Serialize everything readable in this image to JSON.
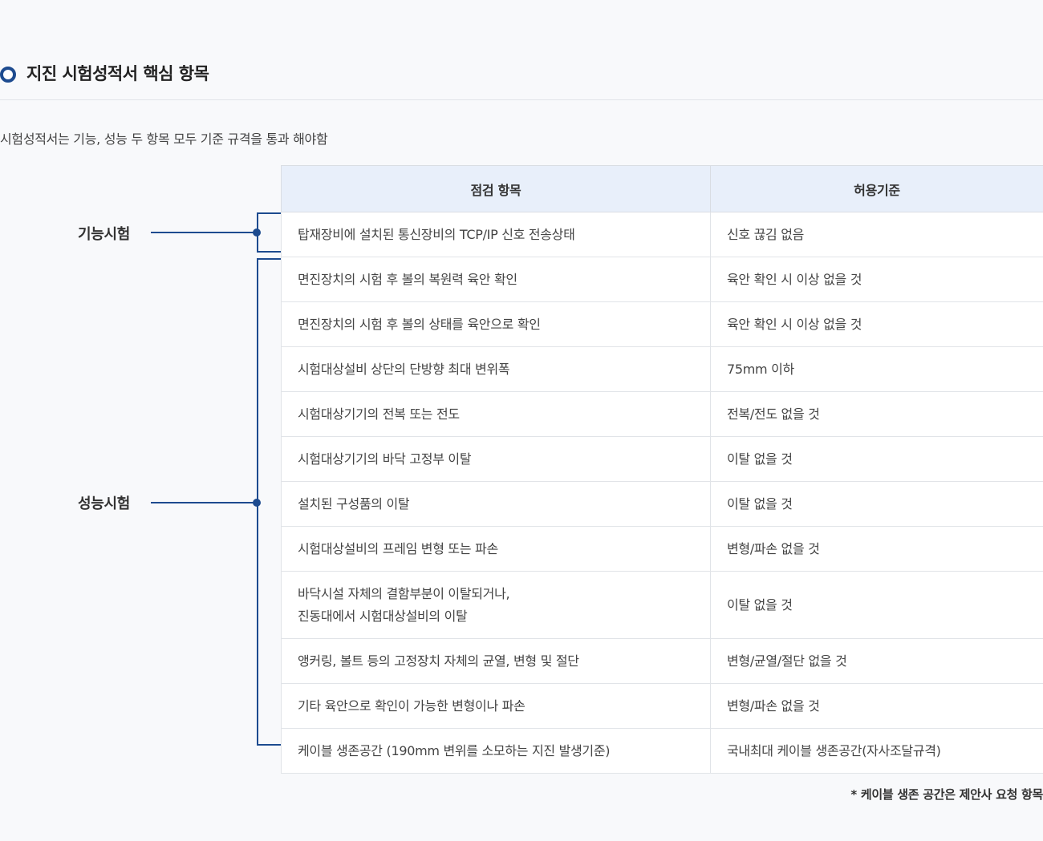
{
  "section": {
    "title": "지진 시험성적서 핵심 항목",
    "intro": "시험성적서는 기능, 성능 두 항목 모두 기준 규격을 통과 해야함"
  },
  "groups": {
    "function": "기능시험",
    "performance": "성능시험"
  },
  "table": {
    "headers": [
      "점검 항목",
      "허용기준"
    ],
    "rows": [
      {
        "item": "탑재장비에 설치된 통신장비의 TCP/IP 신호 전송상태",
        "criterion": "신호 끊김 없음"
      },
      {
        "item": "면진장치의 시험 후 볼의 복원력 육안 확인",
        "criterion": "육안 확인 시 이상 없을 것"
      },
      {
        "item": "면진장치의 시험 후 볼의 상태를 육안으로 확인",
        "criterion": "육안 확인 시 이상 없을 것"
      },
      {
        "item": "시험대상설비 상단의 단방향 최대 변위폭",
        "criterion": "75mm 이하"
      },
      {
        "item": "시험대상기기의 전복 또는 전도",
        "criterion": "전복/전도 없을 것"
      },
      {
        "item": "시험대상기기의 바닥 고정부 이탈",
        "criterion": "이탈 없을 것"
      },
      {
        "item": "설치된 구성품의 이탈",
        "criterion": "이탈 없을 것"
      },
      {
        "item": "시험대상설비의 프레임 변형 또는 파손",
        "criterion": "변형/파손 없을 것"
      },
      {
        "item_line1": "바닥시설 자체의 결함부분이 이탈되거나,",
        "item_line2": "진동대에서 시험대상설비의 이탈",
        "criterion": "이탈 없을 것"
      },
      {
        "item": "앵커링, 볼트 등의 고정장치 자체의 균열, 변형 및 절단",
        "criterion": "변형/균열/절단 없을 것"
      },
      {
        "item": "기타 육안으로 확인이 가능한 변형이나 파손",
        "criterion": "변형/파손 없을 것"
      },
      {
        "item": "케이블 생존공간 (190mm 변위를 소모하는 지진 발생기준)",
        "criterion": "국내최대 케이블 생존공간(자사조달규격)"
      }
    ]
  },
  "footnote": "* 케이블 생존 공간은 제안사 요청 항목",
  "colors": {
    "accent": "#1d4b8f",
    "header_bg": "#e8effa",
    "page_bg": "#f8f9fb"
  }
}
